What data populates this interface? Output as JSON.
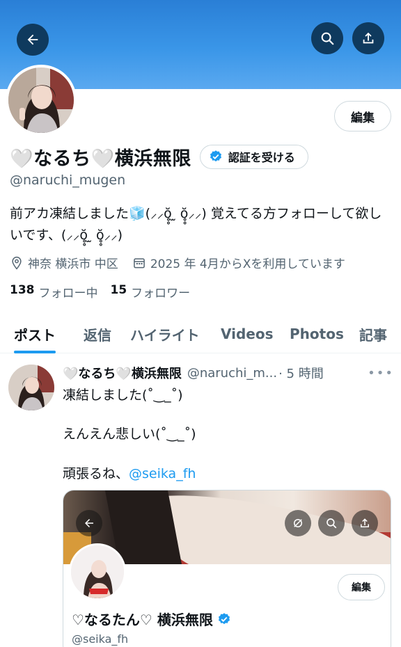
{
  "header": {
    "back_icon": "arrow-left-icon",
    "search_icon": "search-icon",
    "share_icon": "share-icon",
    "banner_color": "#3a96e8"
  },
  "profile": {
    "display_name": "🤍なるち🤍横浜無限",
    "edit_label": "編集",
    "verify_label": "認証を受ける",
    "handle": "@naruchi_mugen",
    "bio": "前アカ凍結しました🧊(⸝⸝ŏ̥̥ ̫ ŏ̥̥⸝⸝) 覚えてる方フォローして欲しいです、(⸝⸝ŏ̥̥ ̫ ŏ̥̥⸝⸝)",
    "location": "神奈 横浜市 中区",
    "joined": "2025 年 4月からXを利用しています",
    "following_count": "138",
    "following_label": "フォロー中",
    "followers_count": "15",
    "followers_label": "フォロワー",
    "accent_color": "#1d9bf0"
  },
  "tabs": [
    {
      "label": "ポスト",
      "active": true
    },
    {
      "label": "返信",
      "active": false
    },
    {
      "label": "ハイライト",
      "active": false
    },
    {
      "label": "Videos",
      "active": false
    },
    {
      "label": "Photos",
      "active": false
    },
    {
      "label": "記事",
      "active": false
    }
  ],
  "post": {
    "author": "🤍なるち🤍横浜無限",
    "handle": "@naruchi_m...",
    "time": "· 5 時間",
    "more_icon": "more-icon",
    "line1": "凍結しました(˚‿_˚)",
    "line2": "えんえん悲しい(˚‿_˚)",
    "line3_prefix": "頑張るね、",
    "mention": "@seika_fh"
  },
  "embedded_card": {
    "edit_label": "編集",
    "name": "♡なるたん♡ 横浜無限",
    "handle": "@seika_fh"
  }
}
